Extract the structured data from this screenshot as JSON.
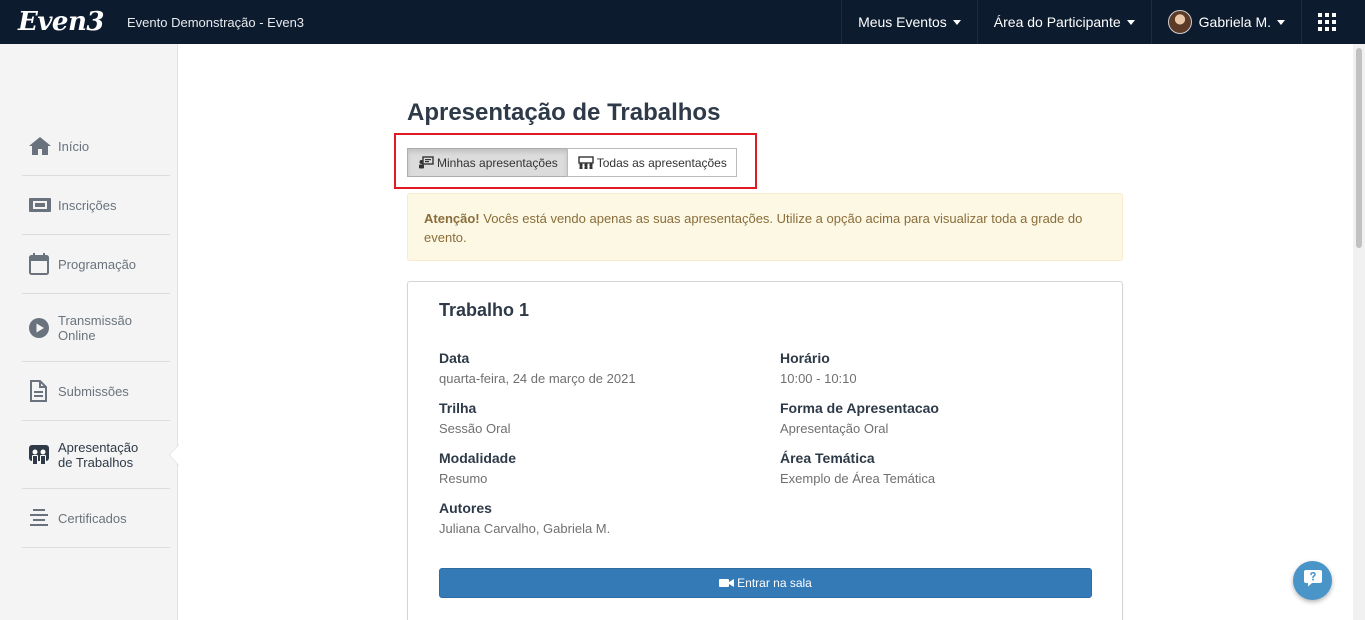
{
  "header": {
    "logo": "Even3",
    "event_title": "Evento Demonstração - Even3",
    "nav": {
      "my_events": "Meus Eventos",
      "participant_area": "Área do Participante",
      "user_name": "Gabriela M."
    }
  },
  "sidebar": {
    "items": [
      {
        "label": "Início",
        "icon": "home-icon"
      },
      {
        "label": "Inscrições",
        "icon": "ticket-icon"
      },
      {
        "label": "Programação",
        "icon": "calendar-icon"
      },
      {
        "label_line1": "Transmissão",
        "label_line2": "Online",
        "icon": "play-icon"
      },
      {
        "label": "Submissões",
        "icon": "document-icon"
      },
      {
        "label_line1": "Apresentação",
        "label_line2": "de Trabalhos",
        "icon": "presentation-icon",
        "active": true
      },
      {
        "label": "Certificados",
        "icon": "certificate-icon"
      }
    ]
  },
  "main": {
    "title": "Apresentação de Trabalhos",
    "toggle": {
      "mine": "Minhas apresentações",
      "all": "Todas as apresentações",
      "selected": "mine"
    },
    "alert": {
      "strong": "Atenção!",
      "text": " Vocês está vendo apenas as suas apresentações. Utilize a opção acima para visualizar toda a grade do evento."
    },
    "card": {
      "title": "Trabalho 1",
      "fields": {
        "date_label": "Data",
        "date_value": "quarta-feira, 24 de março de 2021",
        "time_label": "Horário",
        "time_value": "10:00 - 10:10",
        "track_label": "Trilha",
        "track_value": "Sessão Oral",
        "format_label": "Forma de Apresentacao",
        "format_value": "Apresentação Oral",
        "modality_label": "Modalidade",
        "modality_value": "Resumo",
        "area_label": "Área Temática",
        "area_value": "Exemplo de Área Temática",
        "authors_label": "Autores",
        "authors_value": "Juliana Carvalho, Gabriela M."
      },
      "enter_button": "Entrar na sala"
    }
  },
  "colors": {
    "topbar": "#0d1b2e",
    "primary": "#337ab7",
    "alert_bg": "#fcf8e3",
    "highlight_box": "#e01b24"
  }
}
